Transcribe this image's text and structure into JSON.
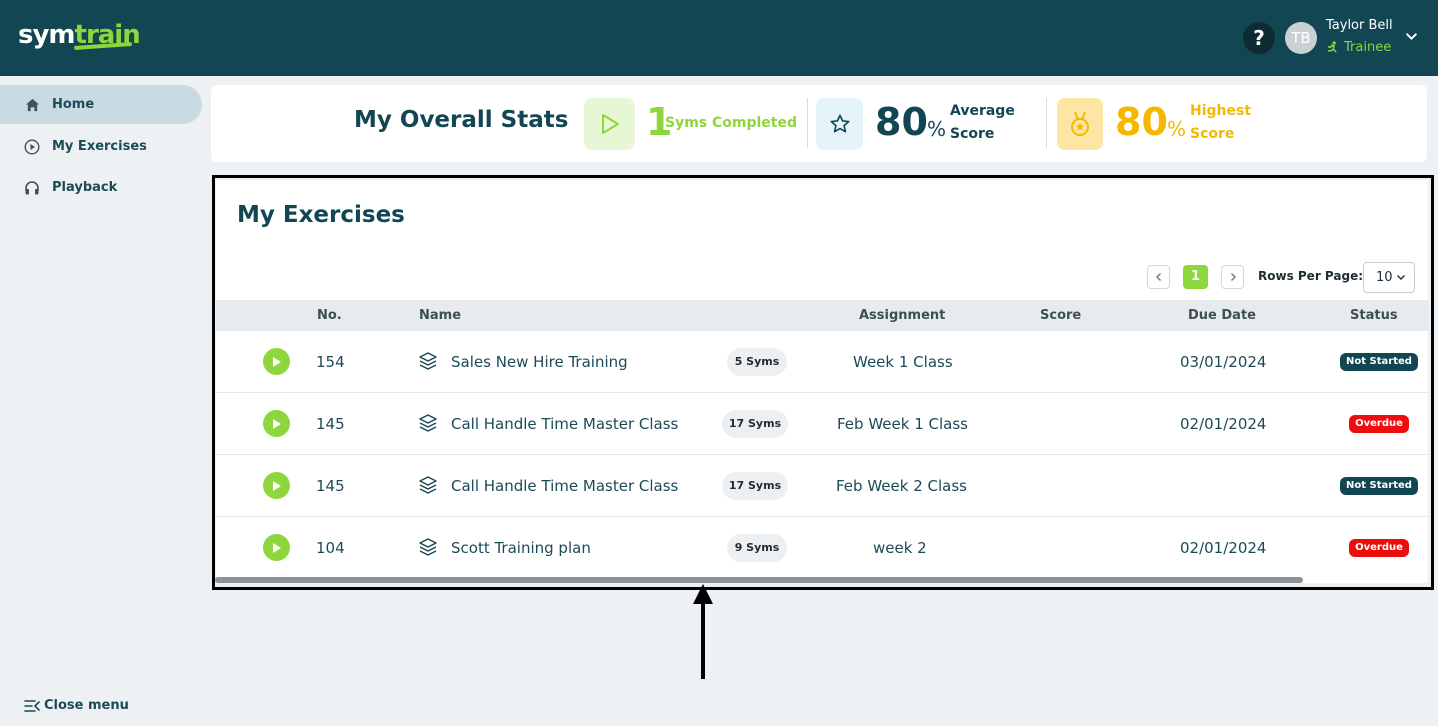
{
  "header": {
    "logo_part1": "sym",
    "logo_part2": "train",
    "help_label": "?",
    "avatar_initials": "TB",
    "user_name": "Taylor Bell",
    "user_role": "Trainee"
  },
  "sidebar": {
    "items": [
      {
        "label": "Home",
        "icon": "home-icon",
        "active": true
      },
      {
        "label": "My Exercises",
        "icon": "play-circle-icon",
        "active": false
      },
      {
        "label": "Playback",
        "icon": "headphones-icon",
        "active": false
      }
    ],
    "close_menu_label": "Close menu"
  },
  "stats": {
    "title": "My Overall Stats",
    "completed_value": "1",
    "completed_label": "Syms Completed",
    "average_value": "80",
    "average_unit": "%",
    "average_label_1": "Average",
    "average_label_2": "Score",
    "highest_value": "80",
    "highest_unit": "%",
    "highest_label_1": "Highest",
    "highest_label_2": "Score",
    "colors": {
      "green": "#8dd63c",
      "teal": "#124653",
      "gold": "#f5b800"
    }
  },
  "exercises": {
    "title": "My Exercises",
    "pagination": {
      "current_page": "1"
    },
    "rows_per_page_label": "Rows Per Page:",
    "rows_per_page_value": "10",
    "columns": [
      "No.",
      "Name",
      "Assignment",
      "Score",
      "Due Date",
      "Status"
    ],
    "rows": [
      {
        "no": "154",
        "name": "Sales New Hire Training",
        "syms": "5 Syms",
        "assignment": "Week 1 Class",
        "score": "",
        "due": "03/01/2024",
        "status": "Not Started"
      },
      {
        "no": "145",
        "name": "Call Handle Time Master Class",
        "syms": "17 Syms",
        "assignment": "Feb Week 1 Class",
        "score": "",
        "due": "02/01/2024",
        "status": "Overdue"
      },
      {
        "no": "145",
        "name": "Call Handle Time Master Class",
        "syms": "17 Syms",
        "assignment": "Feb Week 2 Class",
        "score": "",
        "due": "",
        "status": "Not Started"
      },
      {
        "no": "104",
        "name": "Scott Training plan",
        "syms": "9 Syms",
        "assignment": "week 2",
        "score": "",
        "due": "02/01/2024",
        "status": "Overdue"
      }
    ]
  }
}
